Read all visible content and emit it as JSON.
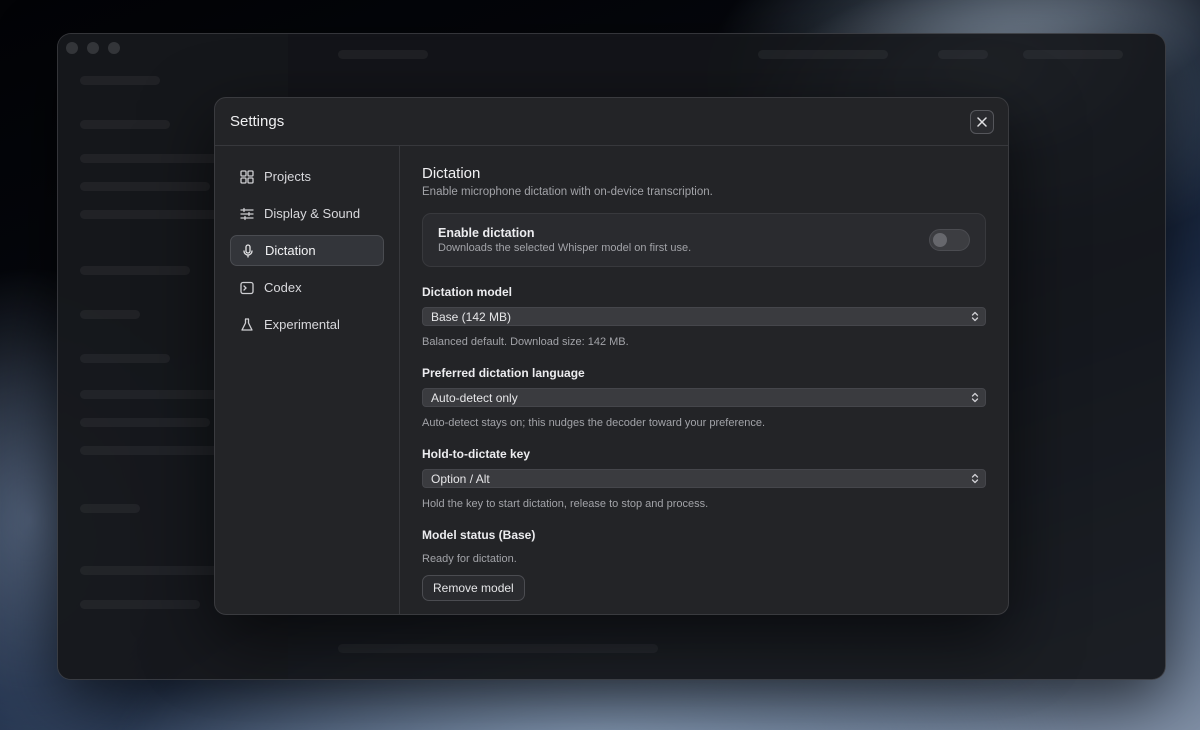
{
  "dialog": {
    "title": "Settings",
    "close_icon": "close-icon"
  },
  "nav": {
    "items": [
      {
        "label": "Projects",
        "icon": "grid-icon"
      },
      {
        "label": "Display & Sound",
        "icon": "sliders-icon"
      },
      {
        "label": "Dictation",
        "icon": "microphone-icon",
        "active": true
      },
      {
        "label": "Codex",
        "icon": "terminal-icon"
      },
      {
        "label": "Experimental",
        "icon": "flask-icon"
      }
    ]
  },
  "dictation": {
    "title": "Dictation",
    "description": "Enable microphone dictation with on-device transcription.",
    "enable": {
      "title": "Enable dictation",
      "subtitle": "Downloads the selected Whisper model on first use.",
      "enabled": false
    },
    "model": {
      "label": "Dictation model",
      "value": "Base (142 MB)",
      "help": "Balanced default. Download size: 142 MB."
    },
    "language": {
      "label": "Preferred dictation language",
      "value": "Auto-detect only",
      "help": "Auto-detect stays on; this nudges the decoder toward your preference."
    },
    "hold_key": {
      "label": "Hold-to-dictate key",
      "value": "Option / Alt",
      "help": "Hold the key to start dictation, release to stop and process."
    },
    "status": {
      "label": "Model status (Base)",
      "text": "Ready for dictation.",
      "remove_label": "Remove model"
    }
  }
}
